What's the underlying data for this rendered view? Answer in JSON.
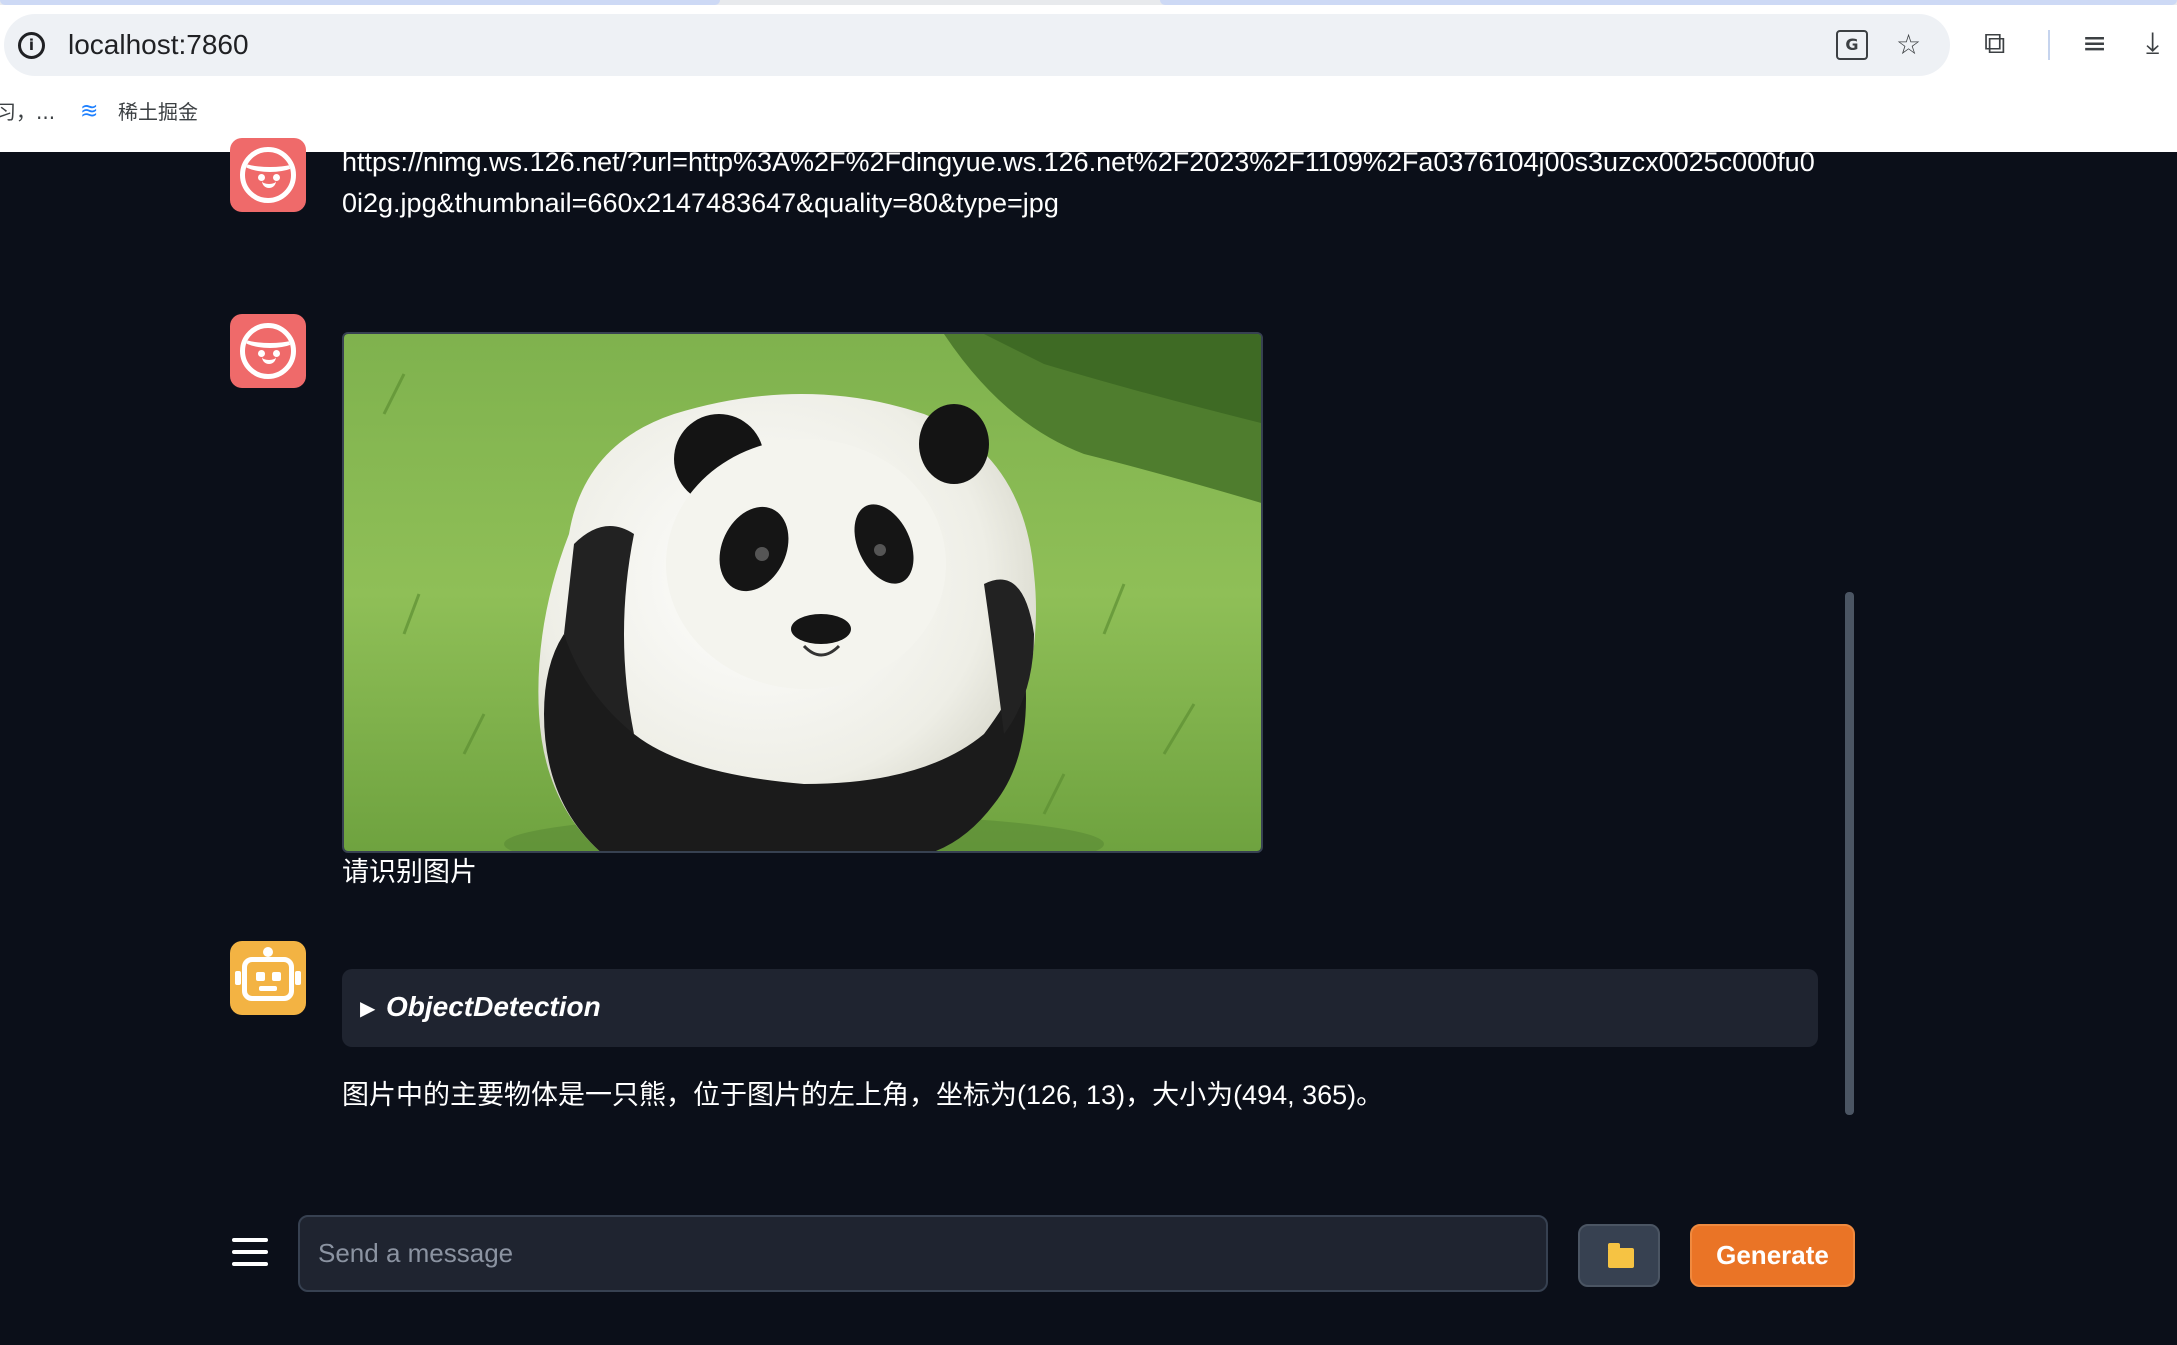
{
  "browser": {
    "url": "localhost:7860",
    "info_icon": "i",
    "translate_icon": "G",
    "bookmarks": [
      {
        "label": "习，..."
      },
      {
        "label": "稀土掘金"
      }
    ]
  },
  "chat": {
    "messages": [
      {
        "role": "user",
        "type": "text",
        "text": "https://nimg.ws.126.net/?url=http%3A%2F%2Fdingyue.ws.126.net%2F2023%2F1109%2Fa0376104j00s3uzcx0025c000fu00i2g.jpg&thumbnail=660x2147483647&quality=80&type=jpg"
      },
      {
        "role": "user",
        "type": "image",
        "caption": "请识别图片"
      },
      {
        "role": "assistant",
        "tool": "ObjectDetection",
        "text": "图片中的主要物体是一只熊，位于图片的左上角，坐标为(126, 13)，大小为(494, 365)。"
      }
    ]
  },
  "input": {
    "placeholder": "Send a message",
    "value": "",
    "generate_label": "Generate"
  },
  "colors": {
    "background": "#0b0f19",
    "user_avatar": "#ef6a6a",
    "bot_avatar": "#f3b343",
    "accent_button": "#ea7426"
  }
}
